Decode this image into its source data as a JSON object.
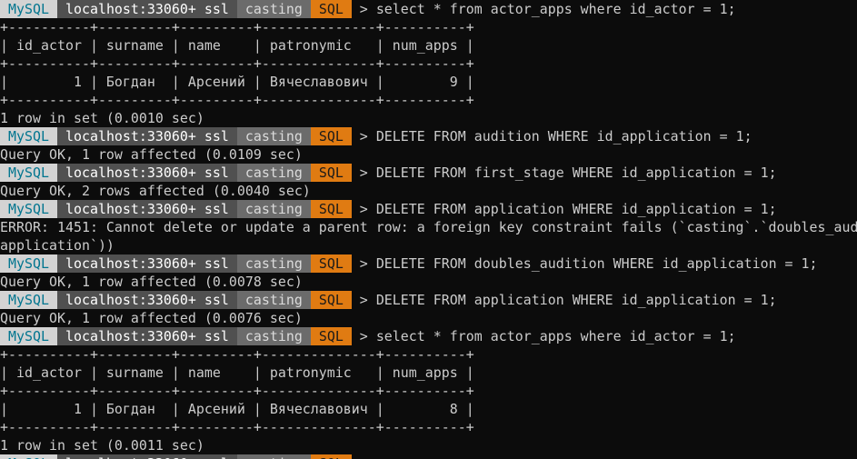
{
  "prompt": {
    "mysql": " MySQL ",
    "host": " localhost:33060+ ssl ",
    "schema": " casting ",
    "mode": " SQL ",
    "arrow": " > "
  },
  "colors": {
    "background": "#0c0c0c",
    "mysql_bg": "#d3d3d3",
    "mysql_fg": "#00758f",
    "host_bg": "#505050",
    "schema_bg": "#6b6b6b",
    "mode_bg": "#e07b12"
  },
  "lines": [
    {
      "type": "prompt",
      "text": "select * from actor_apps where id_actor = 1;"
    },
    {
      "type": "output",
      "text": "+----------+---------+---------+--------------+----------+"
    },
    {
      "type": "output",
      "text": "| id_actor | surname | name    | patronymic   | num_apps |"
    },
    {
      "type": "output",
      "text": "+----------+---------+---------+--------------+----------+"
    },
    {
      "type": "output",
      "text": "|        1 | Богдан  | Арсений | Вячеславович |        9 |"
    },
    {
      "type": "output",
      "text": "+----------+---------+---------+--------------+----------+"
    },
    {
      "type": "output",
      "text": "1 row in set (0.0010 sec)"
    },
    {
      "type": "prompt",
      "text": "DELETE FROM audition WHERE id_application = 1;"
    },
    {
      "type": "output",
      "text": "Query OK, 1 row affected (0.0109 sec)"
    },
    {
      "type": "prompt",
      "text": "DELETE FROM first_stage WHERE id_application = 1;"
    },
    {
      "type": "output",
      "text": "Query OK, 2 rows affected (0.0040 sec)"
    },
    {
      "type": "prompt",
      "text": "DELETE FROM application WHERE id_application = 1;"
    },
    {
      "type": "output",
      "text": "ERROR: 1451: Cannot delete or update a parent row: a foreign key constraint fails (`casting`.`doubles_aud"
    },
    {
      "type": "output",
      "text": "application`))"
    },
    {
      "type": "prompt",
      "text": "DELETE FROM doubles_audition WHERE id_application = 1;"
    },
    {
      "type": "output",
      "text": "Query OK, 1 row affected (0.0078 sec)"
    },
    {
      "type": "prompt",
      "text": "DELETE FROM application WHERE id_application = 1;"
    },
    {
      "type": "output",
      "text": "Query OK, 1 row affected (0.0076 sec)"
    },
    {
      "type": "prompt",
      "text": "select * from actor_apps where id_actor = 1;"
    },
    {
      "type": "output",
      "text": "+----------+---------+---------+--------------+----------+"
    },
    {
      "type": "output",
      "text": "| id_actor | surname | name    | patronymic   | num_apps |"
    },
    {
      "type": "output",
      "text": "+----------+---------+---------+--------------+----------+"
    },
    {
      "type": "output",
      "text": "|        1 | Богдан  | Арсений | Вячеславович |        8 |"
    },
    {
      "type": "output",
      "text": "+----------+---------+---------+--------------+----------+"
    },
    {
      "type": "output",
      "text": "1 row in set (0.0011 sec)"
    }
  ]
}
